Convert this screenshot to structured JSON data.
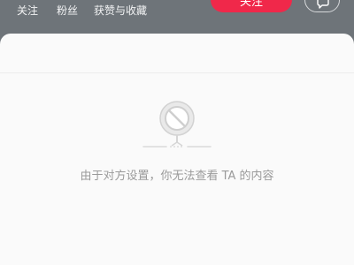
{
  "header": {
    "stats": {
      "following_label": "关注",
      "fans_label": "粉丝",
      "likes_label": "获赞与收藏"
    },
    "follow_button_label": "关注",
    "message_icon": "message-icon"
  },
  "content": {
    "empty_icon": "blocked-privacy-icon",
    "empty_message": "由于对方设置，你无法查看 TA 的内容"
  },
  "colors": {
    "accent": "#f0284a",
    "header_background": "#6e7479",
    "panel_background": "#fafafa",
    "empty_text": "#9a9a9a"
  }
}
